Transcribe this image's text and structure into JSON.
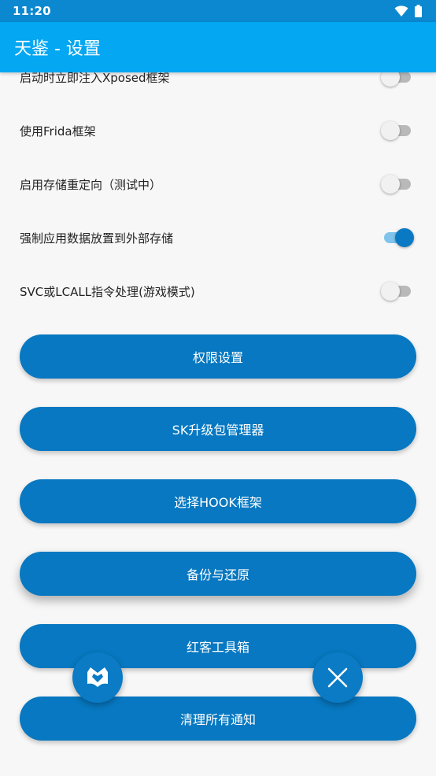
{
  "status_bar": {
    "time": "11:20"
  },
  "app_bar": {
    "title": "天鉴 - 设置"
  },
  "settings": [
    {
      "label": "启动时立即注入Xposed框架",
      "enabled": false
    },
    {
      "label": "使用Frida框架",
      "enabled": false
    },
    {
      "label": "启用存储重定向（测试中）",
      "enabled": false
    },
    {
      "label": "强制应用数据放置到外部存储",
      "enabled": true
    },
    {
      "label": "SVC或LCALL指令处理(游戏模式)",
      "enabled": false
    }
  ],
  "buttons": [
    {
      "label": "权限设置"
    },
    {
      "label": "SK升级包管理器"
    },
    {
      "label": "选择HOOK框架"
    },
    {
      "label": "备份与还原"
    },
    {
      "label": "红客工具箱"
    },
    {
      "label": "清理所有通知"
    }
  ],
  "floating_buttons": {
    "left_icon": "book-fox-icon",
    "right_icon": "close-icon"
  },
  "colors": {
    "status_bar": "#0b88cf",
    "app_bar": "#03a7f2",
    "button": "#0778c1",
    "switch_on": "#0a79c4",
    "switch_on_track": "#7fc4ec",
    "switch_off_track": "#b9b9b9"
  }
}
